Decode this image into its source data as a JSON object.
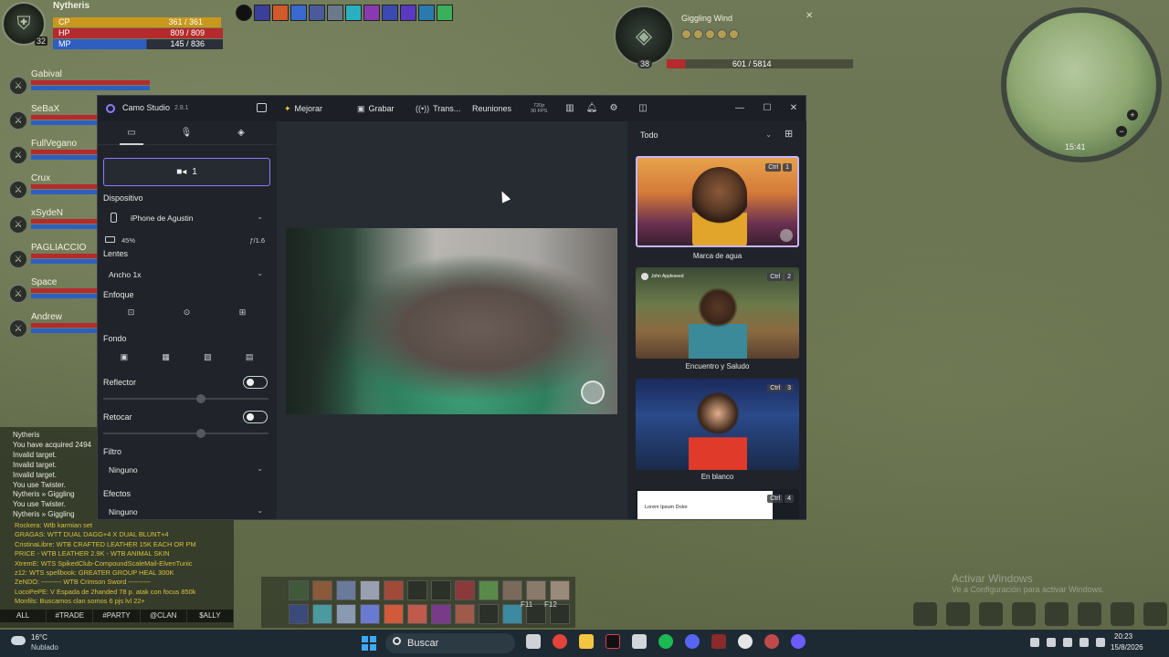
{
  "game": {
    "player": {
      "name": "Nytheris",
      "level": "32",
      "cp_label": "CP",
      "cp_value": "361 / 361",
      "hp_label": "HP",
      "hp_value": "809 / 809",
      "mp_label": "MP",
      "mp_value": "145 / 836"
    },
    "party": [
      {
        "name": "Gabival"
      },
      {
        "name": "SeBaX"
      },
      {
        "name": "FullVegano"
      },
      {
        "name": "Crux"
      },
      {
        "name": "xSydeN"
      },
      {
        "name": "PAGLIACCIO"
      },
      {
        "name": "Space"
      },
      {
        "name": "Andrew"
      }
    ],
    "target": {
      "name": "Giggling Wind",
      "level": "38",
      "hp_value": "601 / 5814",
      "close_symbol": "✕"
    },
    "minimap": {
      "time": "15:41",
      "plus": "+",
      "minus": "−"
    },
    "system_chat": [
      "Nytheris",
      "You have acquired 2494",
      "Invalid target.",
      "Invalid target.",
      "Invalid target.",
      "You use Twister.",
      "Nytheris » Giggling",
      "You use Twister.",
      "Nytheris » Giggling"
    ],
    "main_chat": [
      "Rockera: Wtb karmian set",
      "GRAGAS: WTT DUAL DAGG+4 X DUAL BLUNT+4",
      "CristinaLibre: WTB CRAFTED LEATHER 15K EACH OR PM",
      "PRICE - WTB LEATHER 2.9K - WTB ANIMAL SKIN",
      "XtremE: WTS SpikedClub-CompoundScaleMail-ElvenTunic",
      "z12: WTS spellbook: GREATER GROUP HEAL 300K",
      "ZeNDO: --------- WTB Crimson Sword ----------",
      "LocoPePE: V Espada de 2handed 78 p. atak con focus 850k",
      "Monfils: Buscamos clan somos 6 pjs lvl 22+"
    ],
    "chat_tabs": [
      "ALL",
      "#TRADE",
      "#PARTY",
      "@CLAN",
      "$ALLY"
    ],
    "actionbar_keys": [
      "F11",
      "F12"
    ],
    "watermark": {
      "title": "Activar Windows",
      "subtitle": "Ve a Configuración para activar Windows."
    }
  },
  "camo": {
    "title": "Camo Studio",
    "version": "2.8.1",
    "toolbar": {
      "mejorar": "Mejorar",
      "grabar": "Grabar",
      "trans": "Trans...",
      "reuniones": "Reuniones",
      "res_line1": "720p",
      "res_line2": "30 FPS"
    },
    "window_controls": {
      "minimize": "—",
      "maximize": "☐",
      "close": "✕"
    },
    "left_panel": {
      "source_label": "1",
      "dispositivo_label": "Dispositivo",
      "device_value": "iPhone de Agustin",
      "battery": "45%",
      "aperture": "ƒ/1.6",
      "lentes_label": "Lentes",
      "lentes_value": "Ancho 1x",
      "enfoque_label": "Enfoque",
      "fondo_label": "Fondo",
      "reflector_label": "Reflector",
      "retocar_label": "Retocar",
      "filtro_label": "Filtro",
      "filtro_value": "Ninguno",
      "efectos_label": "Efectos",
      "efectos_value": "Ninguno"
    },
    "scene_panel": {
      "filter_value": "Todo",
      "scenes": [
        {
          "label": "Marca de agua",
          "shortcut_key": "Ctrl",
          "shortcut_num": "1"
        },
        {
          "label": "Encuentro y Saludo",
          "shortcut_key": "Ctrl",
          "shortcut_num": "2",
          "caller": "John Appleseed"
        },
        {
          "label": "En blanco",
          "shortcut_key": "Ctrl",
          "shortcut_num": "3"
        },
        {
          "label": "",
          "shortcut_key": "Ctrl",
          "shortcut_num": "4",
          "doc_text": "Lorem Ipsum Dolor"
        }
      ]
    }
  },
  "taskbar": {
    "weather_temp": "16°C",
    "weather_desc": "Nublado",
    "search_placeholder": "Buscar",
    "clock_time": "20:23",
    "clock_date": "15/8/2026"
  }
}
